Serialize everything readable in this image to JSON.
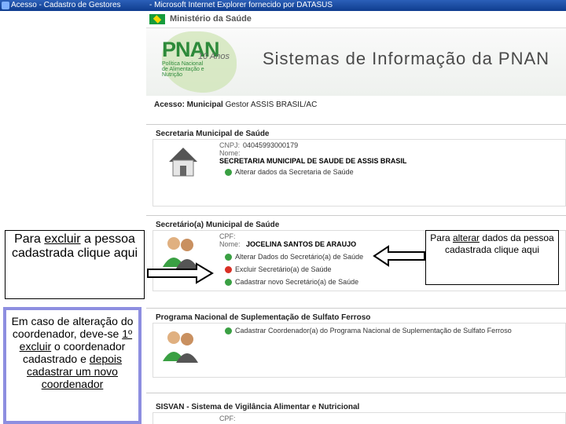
{
  "browser": {
    "tab_title": "Acesso - Cadastro de Gestores",
    "window_title": "- Microsoft Internet Explorer fornecido por DATASUS"
  },
  "header": {
    "ministry": "Ministério da Saúde",
    "logo_text": "PNAN",
    "logo_anos": "10 Anos",
    "logo_subtitle": "Política Nacional de Alimentação e Nutrição",
    "system_title": "Sistemas de Informação da PNAN"
  },
  "access": {
    "label": "Acesso: Municipal",
    "value": "Gestor ASSIS BRASIL/AC"
  },
  "secretaria": {
    "title": "Secretaria Municipal de Saúde",
    "cnpj_label": "CNPJ:",
    "cnpj_value": "04045993000179",
    "nome_label": "Nome:",
    "nome_value": "SECRETARIA MUNICIPAL DE SAUDE DE ASSIS BRASIL",
    "link_alterar": "Alterar dados da Secretaria de Saúde"
  },
  "secretario": {
    "title": "Secretário(a) Municipal de Saúde",
    "cpf_label": "CPF:",
    "nome_label": "Nome:",
    "nome_value": "JOCELINA SANTOS DE ARAUJO",
    "link_alterar": "Alterar Dados do Secretário(a) de Saúde",
    "link_excluir": "Excluir Secretário(a) de Saúde",
    "link_cadastrar": "Cadastrar novo Secretário(a) de Saúde"
  },
  "programa": {
    "title": "Programa Nacional de Suplementação de Sulfato Ferroso",
    "link_cadastrar": "Cadastrar Coordenador(a) do Programa Nacional de Suplementação de Sulfato Ferroso"
  },
  "sisvan": {
    "title": "SISVAN - Sistema de Vigilância Alimentar e Nutricional",
    "cpf_label": "CPF:"
  },
  "callouts": {
    "left_1": "Para",
    "left_underline": "excluir",
    "left_2": "a pessoa cadastrada clique aqui",
    "right_1": "Para",
    "right_underline": "alterar",
    "right_2": "dados da pessoa cadastrada clique aqui",
    "bottom_1": "Em caso de alteração do coordenador, deve-se",
    "bottom_u1": "1º excluir",
    "bottom_2": "o coordenador cadastrado e",
    "bottom_u2": "depois cadastrar um novo",
    "bottom_3": "coordenador"
  },
  "colors": {
    "green_icon": "#3aa043",
    "red_icon": "#d93025",
    "callout_border": "#8d8ee0"
  }
}
